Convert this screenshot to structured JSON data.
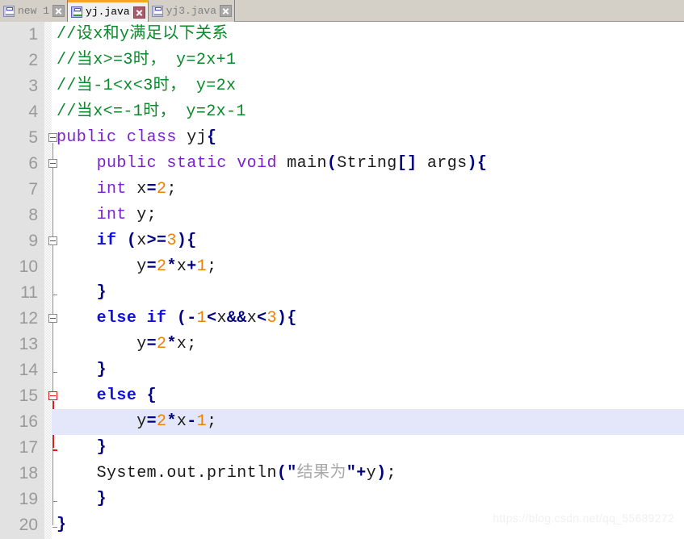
{
  "window": {
    "app": "text-editor",
    "tabbar_bg": "#d4d0c8",
    "active_tab_accent": "#f5a623"
  },
  "tabs": [
    {
      "label": "new 1",
      "icon": "floppy-disk-icon",
      "active": false,
      "close_label": "×",
      "close_style": "grey"
    },
    {
      "label": "yj.java",
      "icon": "floppy-disk-icon",
      "active": true,
      "close_label": "×",
      "close_style": "red"
    },
    {
      "label": "yj3.java",
      "icon": "floppy-disk-icon",
      "active": false,
      "close_label": "×",
      "close_style": "grey"
    }
  ],
  "editor": {
    "language": "java",
    "current_line": 16,
    "total_lines": 20,
    "colors": {
      "comment": "#0a8a2a",
      "keyword": "#7d1fcf",
      "keyword_control": "#1010e0",
      "number": "#f08000",
      "operator": "#000080",
      "string": "#a9a9a9",
      "plain": "#1a1a1a",
      "gutter_bg": "#e2e2e2",
      "line_number": "#9a9a9a",
      "current_line_bg": "#e4e6fa",
      "fold_active": "#e01b1b"
    },
    "lines": [
      {
        "n": 1,
        "text": "//设x和y满足以下关系",
        "tokens": [
          {
            "t": "//设x和y满足以下关系",
            "c": "cmt"
          }
        ]
      },
      {
        "n": 2,
        "text": "//当x>=3时， y=2x+1",
        "tokens": [
          {
            "t": "//当x>=3时， y=2x+1",
            "c": "cmt"
          }
        ]
      },
      {
        "n": 3,
        "text": "//当-1<x<3时， y=2x",
        "tokens": [
          {
            "t": "//当-1<x<3时， y=2x",
            "c": "cmt"
          }
        ]
      },
      {
        "n": 4,
        "text": "//当x<=-1时， y=2x-1",
        "tokens": [
          {
            "t": "//当x<=-1时， y=2x-1",
            "c": "cmt"
          }
        ]
      },
      {
        "n": 5,
        "text": "public class yj{",
        "tokens": [
          {
            "t": "public class ",
            "c": "kw"
          },
          {
            "t": "yj",
            "c": "pln"
          },
          {
            "t": "{",
            "c": "op"
          }
        ]
      },
      {
        "n": 6,
        "text": "    public static void main(String[] args){",
        "tokens": [
          {
            "t": "    ",
            "c": "pln"
          },
          {
            "t": "public static void ",
            "c": "kw"
          },
          {
            "t": "main",
            "c": "pln"
          },
          {
            "t": "(",
            "c": "op"
          },
          {
            "t": "String",
            "c": "pln"
          },
          {
            "t": "[]",
            "c": "op"
          },
          {
            "t": " args",
            "c": "pln"
          },
          {
            "t": ")",
            "c": "op"
          },
          {
            "t": "{",
            "c": "op"
          }
        ]
      },
      {
        "n": 7,
        "text": "    int x=2;",
        "tokens": [
          {
            "t": "    ",
            "c": "pln"
          },
          {
            "t": "int",
            "c": "kw"
          },
          {
            "t": " x",
            "c": "pln"
          },
          {
            "t": "=",
            "c": "op"
          },
          {
            "t": "2",
            "c": "num2"
          },
          {
            "t": ";",
            "c": "pln"
          }
        ]
      },
      {
        "n": 8,
        "text": "    int y;",
        "tokens": [
          {
            "t": "    ",
            "c": "pln"
          },
          {
            "t": "int",
            "c": "kw"
          },
          {
            "t": " y;",
            "c": "pln"
          }
        ]
      },
      {
        "n": 9,
        "text": "    if (x>=3){",
        "tokens": [
          {
            "t": "    ",
            "c": "pln"
          },
          {
            "t": "if",
            "c": "kw2"
          },
          {
            "t": " ",
            "c": "pln"
          },
          {
            "t": "(",
            "c": "op"
          },
          {
            "t": "x",
            "c": "pln"
          },
          {
            "t": ">=",
            "c": "op"
          },
          {
            "t": "3",
            "c": "num2"
          },
          {
            "t": ")",
            "c": "op"
          },
          {
            "t": "{",
            "c": "op"
          }
        ]
      },
      {
        "n": 10,
        "text": "        y=2*x+1;",
        "tokens": [
          {
            "t": "        y",
            "c": "pln"
          },
          {
            "t": "=",
            "c": "op"
          },
          {
            "t": "2",
            "c": "num2"
          },
          {
            "t": "*",
            "c": "op"
          },
          {
            "t": "x",
            "c": "pln"
          },
          {
            "t": "+",
            "c": "op"
          },
          {
            "t": "1",
            "c": "num2"
          },
          {
            "t": ";",
            "c": "pln"
          }
        ]
      },
      {
        "n": 11,
        "text": "    }",
        "tokens": [
          {
            "t": "    ",
            "c": "pln"
          },
          {
            "t": "}",
            "c": "op"
          }
        ]
      },
      {
        "n": 12,
        "text": "    else if (-1<x&&x<3){",
        "tokens": [
          {
            "t": "    ",
            "c": "pln"
          },
          {
            "t": "else if",
            "c": "kw2"
          },
          {
            "t": " ",
            "c": "pln"
          },
          {
            "t": "(-",
            "c": "op"
          },
          {
            "t": "1",
            "c": "num2"
          },
          {
            "t": "<",
            "c": "op"
          },
          {
            "t": "x",
            "c": "pln"
          },
          {
            "t": "&&",
            "c": "op"
          },
          {
            "t": "x",
            "c": "pln"
          },
          {
            "t": "<",
            "c": "op"
          },
          {
            "t": "3",
            "c": "num2"
          },
          {
            "t": ")",
            "c": "op"
          },
          {
            "t": "{",
            "c": "op"
          }
        ]
      },
      {
        "n": 13,
        "text": "        y=2*x;",
        "tokens": [
          {
            "t": "        y",
            "c": "pln"
          },
          {
            "t": "=",
            "c": "op"
          },
          {
            "t": "2",
            "c": "num2"
          },
          {
            "t": "*",
            "c": "op"
          },
          {
            "t": "x",
            "c": "pln"
          },
          {
            "t": ";",
            "c": "pln"
          }
        ]
      },
      {
        "n": 14,
        "text": "    }",
        "tokens": [
          {
            "t": "    ",
            "c": "pln"
          },
          {
            "t": "}",
            "c": "op"
          }
        ]
      },
      {
        "n": 15,
        "text": "    else {",
        "tokens": [
          {
            "t": "    ",
            "c": "pln"
          },
          {
            "t": "else",
            "c": "kw2"
          },
          {
            "t": " ",
            "c": "pln"
          },
          {
            "t": "{",
            "c": "op"
          }
        ]
      },
      {
        "n": 16,
        "text": "        y=2*x-1;",
        "tokens": [
          {
            "t": "        y",
            "c": "pln"
          },
          {
            "t": "=",
            "c": "op"
          },
          {
            "t": "2",
            "c": "num2"
          },
          {
            "t": "*",
            "c": "op"
          },
          {
            "t": "x",
            "c": "pln"
          },
          {
            "t": "-",
            "c": "op"
          },
          {
            "t": "1",
            "c": "num2"
          },
          {
            "t": ";",
            "c": "pln"
          }
        ]
      },
      {
        "n": 17,
        "text": "    }",
        "tokens": [
          {
            "t": "    ",
            "c": "pln"
          },
          {
            "t": "}",
            "c": "op"
          }
        ]
      },
      {
        "n": 18,
        "text": "    System.out.println(\"结果为\"+y);",
        "tokens": [
          {
            "t": "    System.out.println",
            "c": "pln"
          },
          {
            "t": "(\"",
            "c": "op"
          },
          {
            "t": "结果为",
            "c": "str"
          },
          {
            "t": "\"",
            "c": "op"
          },
          {
            "t": "+",
            "c": "op"
          },
          {
            "t": "y",
            "c": "pln"
          },
          {
            "t": ")",
            "c": "op"
          },
          {
            "t": ";",
            "c": "pln"
          }
        ]
      },
      {
        "n": 19,
        "text": "    }",
        "tokens": [
          {
            "t": "    ",
            "c": "pln"
          },
          {
            "t": "}",
            "c": "op"
          }
        ]
      },
      {
        "n": 20,
        "text": "}",
        "tokens": [
          {
            "t": "}",
            "c": "op"
          }
        ]
      }
    ],
    "fold_markers": [
      {
        "line": 5,
        "type": "open",
        "active": false
      },
      {
        "line": 6,
        "type": "open",
        "active": false
      },
      {
        "line": 9,
        "type": "open",
        "active": false
      },
      {
        "line": 11,
        "type": "end",
        "active": false
      },
      {
        "line": 12,
        "type": "open",
        "active": false
      },
      {
        "line": 14,
        "type": "end",
        "active": false
      },
      {
        "line": 15,
        "type": "open",
        "active": true
      },
      {
        "line": 17,
        "type": "end",
        "active": true
      },
      {
        "line": 19,
        "type": "end",
        "active": false
      },
      {
        "line": 20,
        "type": "end",
        "active": false
      }
    ]
  },
  "watermark": {
    "text": "https://blog.csdn.net/qq_55689272"
  }
}
